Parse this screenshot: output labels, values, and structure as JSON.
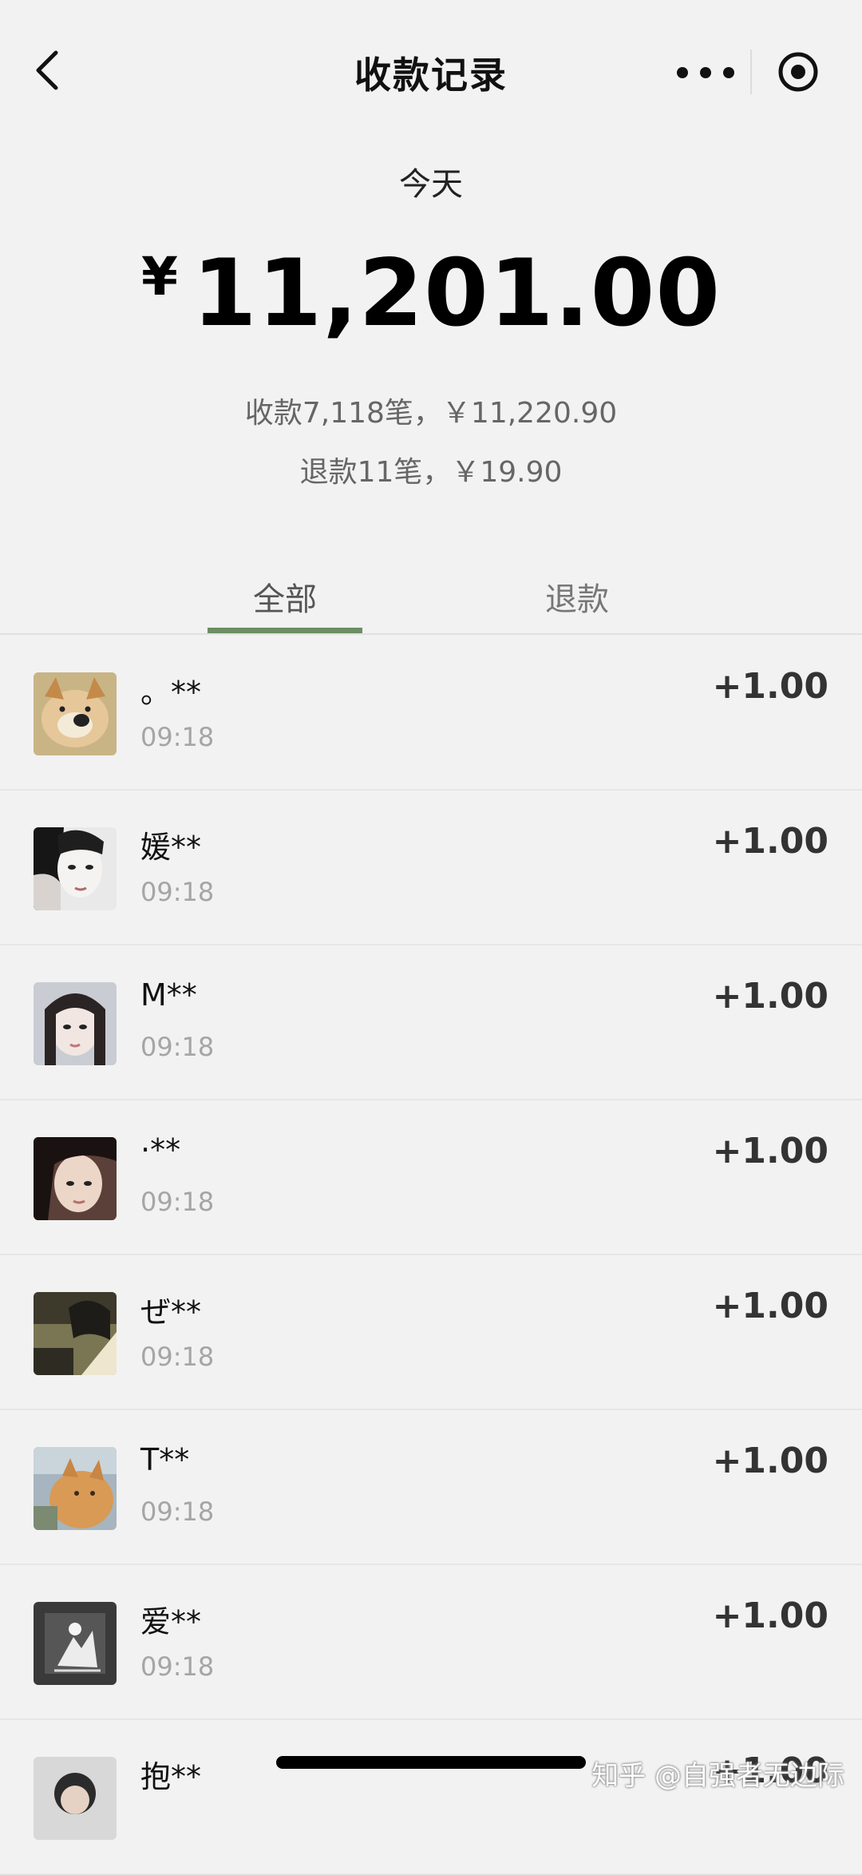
{
  "header": {
    "title": "收款记录"
  },
  "summary": {
    "day_label": "今天",
    "currency_symbol": "¥",
    "total_amount": "11,201.00",
    "income_line": "收款7,118笔，￥11,220.90",
    "refund_line": "退款11笔，￥19.90"
  },
  "tabs": [
    {
      "label": "全部",
      "selected": true
    },
    {
      "label": "退款",
      "selected": false
    }
  ],
  "records": [
    {
      "name": "。**",
      "time": "09:18",
      "amount": "+1.00",
      "avatar": "shiba-dog"
    },
    {
      "name": "媛**",
      "time": "09:18",
      "amount": "+1.00",
      "avatar": "girl-portrait-bw"
    },
    {
      "name": "M**",
      "time": "09:18",
      "amount": "+1.00",
      "avatar": "girl-portrait"
    },
    {
      "name": "·**",
      "time": "09:18",
      "amount": "+1.00",
      "avatar": "girl-portrait-dark"
    },
    {
      "name": "ぜ**",
      "time": "09:18",
      "amount": "+1.00",
      "avatar": "anime-scene"
    },
    {
      "name": "T**",
      "time": "09:18",
      "amount": "+1.00",
      "avatar": "orange-cat"
    },
    {
      "name": "爱**",
      "time": "09:18",
      "amount": "+1.00",
      "avatar": "sketch-figure"
    },
    {
      "name": "抱**",
      "time": "",
      "amount": "+1.00",
      "avatar": "person-photo"
    }
  ],
  "watermark": "知乎 @自强者无边际",
  "colors": {
    "background": "#f2f2f2",
    "tab_indicator": "#6b8e62",
    "secondary_text": "#a5a5a5"
  }
}
